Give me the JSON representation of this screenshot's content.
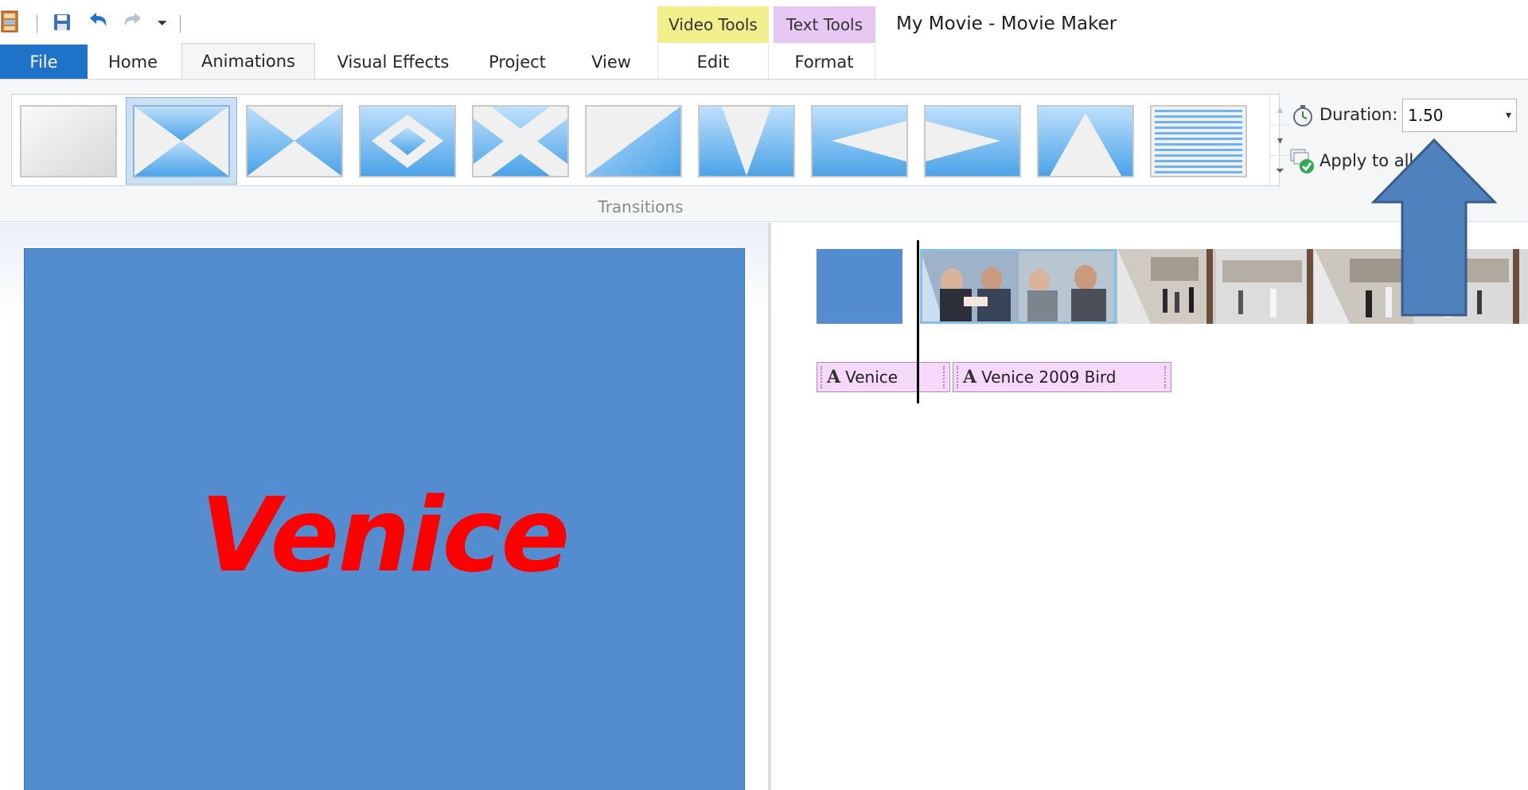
{
  "window": {
    "title": "My Movie - Movie Maker"
  },
  "quick_access": {
    "icons": [
      "movie-maker-app-icon",
      "save-icon",
      "undo-icon",
      "redo-icon",
      "customize-qat-icon"
    ],
    "customize_glyph": "⏷"
  },
  "contextual_tabs": [
    {
      "header": "Video Tools",
      "tab": "Edit",
      "color": "#f1ee8c"
    },
    {
      "header": "Text Tools",
      "tab": "Format",
      "color": "#e6c8f2"
    }
  ],
  "tabs": {
    "file": "File",
    "home": "Home",
    "animations": "Animations",
    "visual_effects": "Visual Effects",
    "project": "Project",
    "view": "View"
  },
  "active_tab": "Animations",
  "ribbon": {
    "transitions": {
      "group_label": "Transitions",
      "items": [
        {
          "name": "No transition",
          "icon": "no-transition-icon"
        },
        {
          "name": "Crossed shapes",
          "icon": "transition-hourglass-icon",
          "selected": true
        },
        {
          "name": "Bowtie horizontal",
          "icon": "transition-bowtie-icon"
        },
        {
          "name": "Diamond",
          "icon": "transition-diamond-icon"
        },
        {
          "name": "Cross",
          "icon": "transition-cross-icon"
        },
        {
          "name": "Diagonal",
          "icon": "transition-diagonal-icon"
        },
        {
          "name": "V shape",
          "icon": "transition-v-icon"
        },
        {
          "name": "Arrow left",
          "icon": "transition-arrow-left-icon"
        },
        {
          "name": "Arrow right",
          "icon": "transition-arrow-right-icon"
        },
        {
          "name": "Triangle up",
          "icon": "transition-triangle-up-icon"
        },
        {
          "name": "Blinds",
          "icon": "transition-blinds-icon"
        }
      ],
      "scroll_up": "▴",
      "scroll_down": "▾",
      "more": "⏷"
    },
    "duration": {
      "label": "Duration:",
      "value": "1.50",
      "caret": "▾"
    },
    "apply_to_all": {
      "label": "Apply to all"
    }
  },
  "preview": {
    "caption_text": "Venice",
    "background_color": "#538ccf",
    "text_color": "#ff0000"
  },
  "storyboard": {
    "captions": [
      {
        "a": "A",
        "text": "Venice"
      },
      {
        "a": "A",
        "text": "Venice 2009 Bird"
      }
    ]
  },
  "annotation": {
    "type": "callout-arrow",
    "points_to": "duration",
    "color": "#4f81bd"
  }
}
